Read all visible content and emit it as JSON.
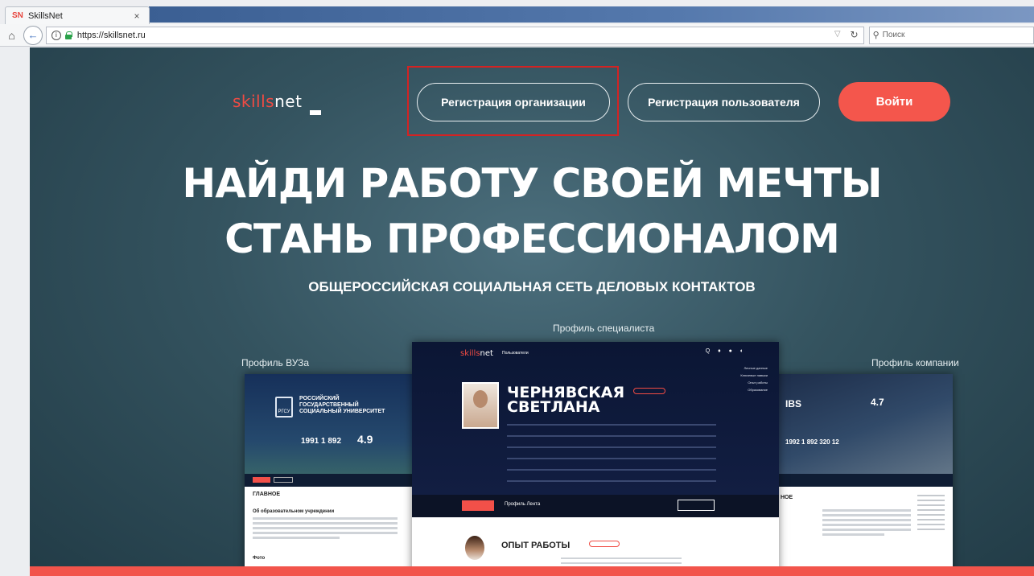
{
  "browser": {
    "tab_title": "SkillsNet",
    "tab_favicon": "SN",
    "tab_close": "×",
    "url": "https://skillsnet.ru",
    "search_placeholder": "Поиск"
  },
  "header": {
    "logo_part1": "skills",
    "logo_part2": "net",
    "btn_org_label": "Регистрация организации",
    "btn_user_label": "Регистрация пользователя",
    "btn_login_label": "Войти"
  },
  "hero": {
    "line1": "НАЙДИ РАБОТУ СВОЕЙ МЕЧТЫ",
    "line2": "СТАНЬ ПРОФЕССИОНАЛОМ",
    "subtitle": "ОБЩЕРОССИЙСКАЯ СОЦИАЛЬНАЯ СЕТЬ ДЕЛОВЫХ КОНТАКТОВ"
  },
  "previews": {
    "specialist_caption": "Профиль специалиста",
    "vuz_caption": "Профиль ВУЗа",
    "company_caption": "Профиль компании"
  },
  "mock_vuz": {
    "logo": "РГСУ",
    "name_line1": "РОССИЙСКИЙ",
    "name_line2": "ГОСУДАРСТВЕННЫЙ",
    "name_line3": "СОЦИАЛЬНЫЙ УНИВЕРСИТЕТ",
    "stats": "1991   1 892",
    "rating": "4.9",
    "section_title": "ГЛАВНОЕ",
    "subsection": "Об образовательном учреждении",
    "subsection2": "Фото"
  },
  "mock_company": {
    "logo": "IBS",
    "rating": "4.7",
    "stats": "1992   1 892   320   12",
    "section_title": "НОЕ"
  },
  "mock_specialist": {
    "logo_part1": "skills",
    "logo_part2": "net",
    "nav": "Пользователи",
    "icons": "Q ♦ ● ◐",
    "name_line1": "ЧЕРНЯВСКАЯ",
    "name_line2": "СВЕТЛАНА",
    "side_menu": [
      "Личные данные",
      "Ключевые навыки",
      "Опыт работы",
      "Образование"
    ],
    "tabs": "Профиль   Лента",
    "bottom_title": "ОПЫТ РАБОТЫ"
  }
}
